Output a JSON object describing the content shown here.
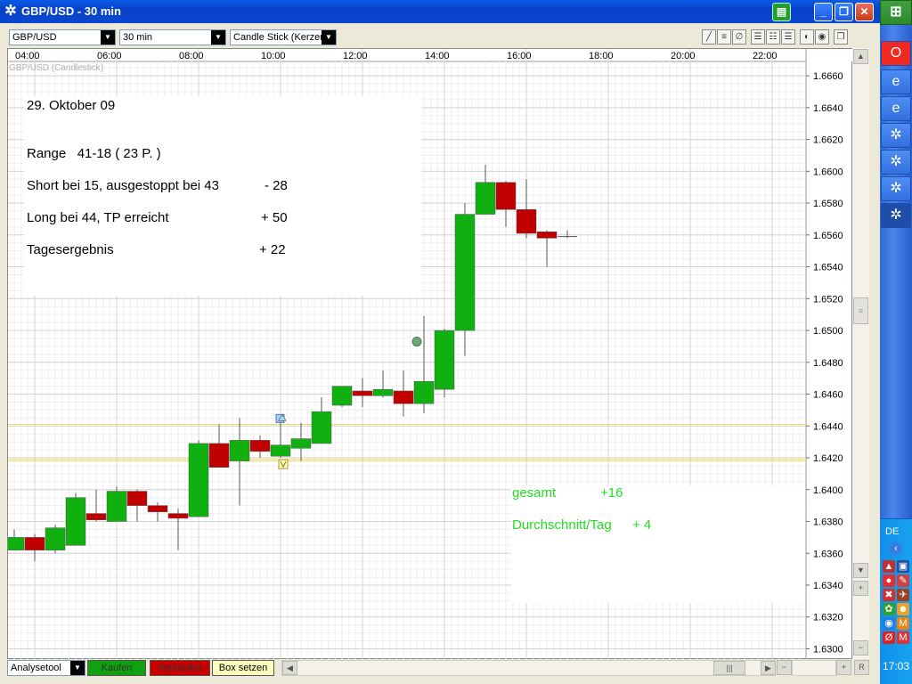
{
  "window": {
    "title": "GBP/USD - 30 min"
  },
  "toolbar": {
    "symbol": "GBP/USD",
    "interval": "30 min",
    "chart_type": "Candle Stick (Kerzen"
  },
  "chart": {
    "overlay_label": "GBP/USD (Candlestick)"
  },
  "note1": {
    "date": "29. Oktober 09",
    "range": "Range   41-18 ( 23 P. )",
    "short": "Short bei 15, ausgestoppt bei 43",
    "short_result": "- 28",
    "long": "Long bei 44, TP erreicht",
    "long_result": "+ 50",
    "total": "Tagesergebnis",
    "total_result": "+ 22"
  },
  "note2": {
    "gesamt": "gesamt",
    "gesamt_val": "+16",
    "avg": "Durchschnitt/Tag",
    "avg_val": "+ 4"
  },
  "bottom": {
    "analyse": "Analysetool",
    "buy": "Kaufen",
    "sell": "Verkaufen",
    "box": "Box setzen",
    "r": "R"
  },
  "taskbar": {
    "lang": "DE",
    "clock": "17:03"
  },
  "colors": {
    "up": "#10b010",
    "down": "#c00000",
    "hline": "#e8e060"
  },
  "chart_data": {
    "type": "candlestick",
    "title": "",
    "x_ticks": [
      "04:00",
      "06:00",
      "08:00",
      "10:00",
      "12:00",
      "14:00",
      "16:00",
      "18:00",
      "20:00",
      "22:00"
    ],
    "y_ticks": [
      "1.6660",
      "1.6640",
      "1.6620",
      "1.6600",
      "1.6580",
      "1.6560",
      "1.6540",
      "1.6520",
      "1.6500",
      "1.6480",
      "1.6460",
      "1.6440",
      "1.6420",
      "1.6400",
      "1.6380",
      "1.6360",
      "1.6340",
      "1.6320",
      "1.6300"
    ],
    "ylim": [
      1.6293,
      1.6669
    ],
    "horizontal_lines": [
      1.6441,
      1.6419,
      1.6418
    ],
    "candles": [
      {
        "time": "03:30",
        "open": 1.6362,
        "high": 1.6375,
        "low": 1.6362,
        "close": 1.637
      },
      {
        "time": "04:00",
        "open": 1.637,
        "high": 1.6372,
        "low": 1.6355,
        "close": 1.6362
      },
      {
        "time": "04:30",
        "open": 1.6362,
        "high": 1.6378,
        "low": 1.636,
        "close": 1.6376
      },
      {
        "time": "05:00",
        "open": 1.6365,
        "high": 1.6398,
        "low": 1.6365,
        "close": 1.6395
      },
      {
        "time": "05:30",
        "open": 1.6385,
        "high": 1.64,
        "low": 1.638,
        "close": 1.6381
      },
      {
        "time": "06:00",
        "open": 1.638,
        "high": 1.6402,
        "low": 1.638,
        "close": 1.6399
      },
      {
        "time": "06:30",
        "open": 1.6399,
        "high": 1.64,
        "low": 1.638,
        "close": 1.639
      },
      {
        "time": "07:00",
        "open": 1.639,
        "high": 1.6392,
        "low": 1.638,
        "close": 1.6386
      },
      {
        "time": "07:30",
        "open": 1.6385,
        "high": 1.6388,
        "low": 1.6362,
        "close": 1.6382
      },
      {
        "time": "08:00",
        "open": 1.6383,
        "high": 1.6431,
        "low": 1.6383,
        "close": 1.6429
      },
      {
        "time": "08:30",
        "open": 1.6429,
        "high": 1.6441,
        "low": 1.6415,
        "close": 1.6414
      },
      {
        "time": "09:00",
        "open": 1.6418,
        "high": 1.6445,
        "low": 1.639,
        "close": 1.6431
      },
      {
        "time": "09:30",
        "open": 1.6431,
        "high": 1.6434,
        "low": 1.642,
        "close": 1.6424
      },
      {
        "time": "10:00",
        "open": 1.6421,
        "high": 1.6446,
        "low": 1.642,
        "close": 1.6428
      },
      {
        "time": "10:30",
        "open": 1.6426,
        "high": 1.6442,
        "low": 1.6418,
        "close": 1.6432
      },
      {
        "time": "11:00",
        "open": 1.6429,
        "high": 1.6458,
        "low": 1.6429,
        "close": 1.6449
      },
      {
        "time": "11:30",
        "open": 1.6453,
        "high": 1.6465,
        "low": 1.6452,
        "close": 1.6465
      },
      {
        "time": "12:00",
        "open": 1.6462,
        "high": 1.647,
        "low": 1.6452,
        "close": 1.6459
      },
      {
        "time": "12:30",
        "open": 1.6459,
        "high": 1.6475,
        "low": 1.6458,
        "close": 1.6463
      },
      {
        "time": "13:00",
        "open": 1.6462,
        "high": 1.6475,
        "low": 1.6446,
        "close": 1.6454
      },
      {
        "time": "13:30",
        "open": 1.6454,
        "high": 1.6509,
        "low": 1.6448,
        "close": 1.6468
      },
      {
        "time": "14:00",
        "open": 1.6463,
        "high": 1.6501,
        "low": 1.6458,
        "close": 1.65
      },
      {
        "time": "14:30",
        "open": 1.65,
        "high": 1.658,
        "low": 1.6484,
        "close": 1.6573
      },
      {
        "time": "15:00",
        "open": 1.6573,
        "high": 1.6604,
        "low": 1.6573,
        "close": 1.6593
      },
      {
        "time": "15:30",
        "open": 1.6593,
        "high": 1.6594,
        "low": 1.6565,
        "close": 1.6576
      },
      {
        "time": "16:00",
        "open": 1.6576,
        "high": 1.6595,
        "low": 1.6558,
        "close": 1.6561
      },
      {
        "time": "16:30",
        "open": 1.6562,
        "high": 1.6563,
        "low": 1.654,
        "close": 1.6558
      },
      {
        "time": "17:00",
        "open": 1.6559,
        "high": 1.6563,
        "low": 1.6558,
        "close": 1.6559
      }
    ],
    "markers": [
      {
        "time": "13:30",
        "price": 1.6493,
        "kind": "signal-dot"
      },
      {
        "time": "10:00",
        "price": 1.6445,
        "kind": "short-entry"
      },
      {
        "time": "10:00",
        "price": 1.6416,
        "kind": "long-entry"
      }
    ]
  }
}
